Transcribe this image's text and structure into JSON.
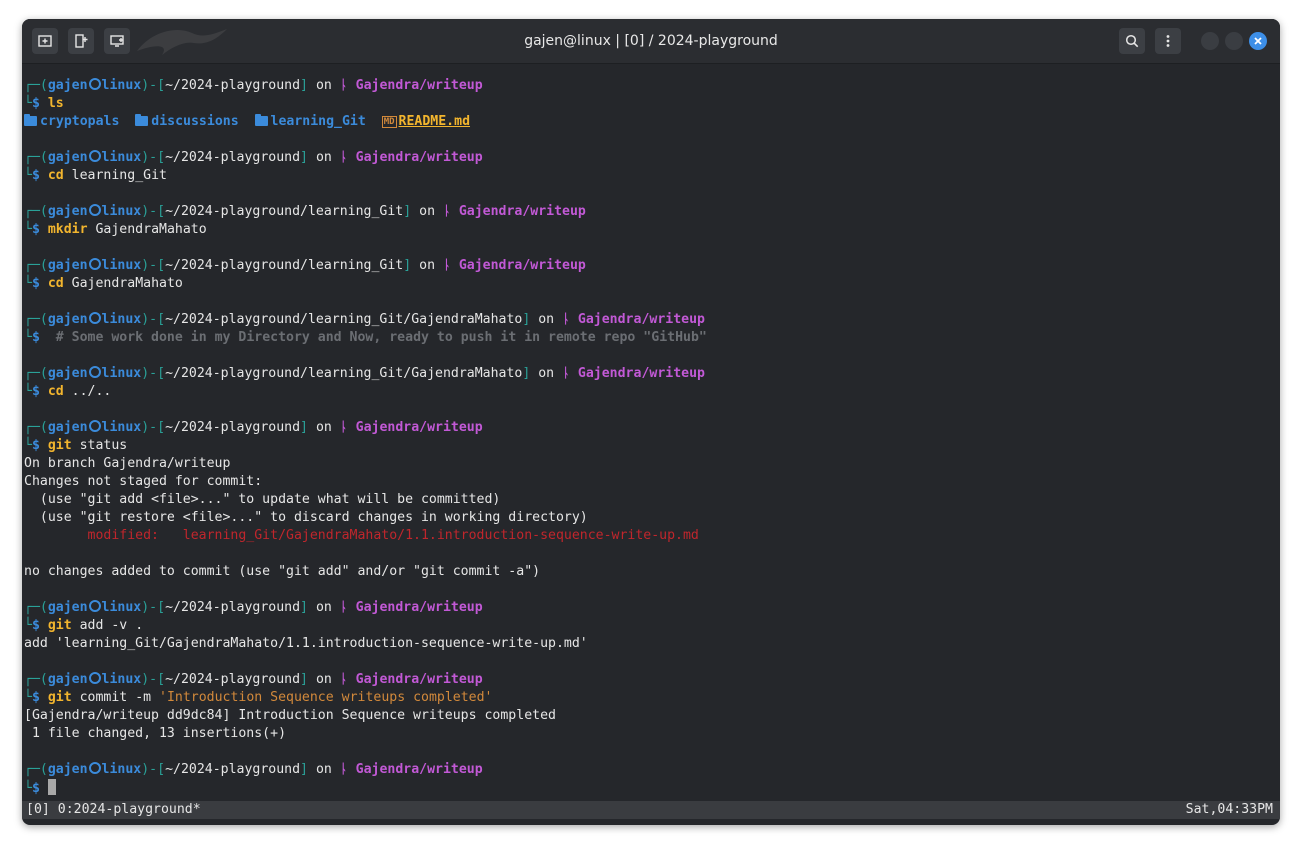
{
  "window": {
    "title": "gajen@linux | [0] / 2024-playground",
    "accent": "#3d8fe8"
  },
  "toolbar": {
    "new_tab_icon": "new-tab-icon",
    "split_icon": "split-view-icon",
    "session_icon": "session-icon",
    "search_icon": "search-icon",
    "menu_icon": "kebab-menu-icon"
  },
  "prompt": {
    "user": "gajen",
    "host": "linux",
    "on": "on",
    "branch": "Gajendra/writeup",
    "dollar": "$"
  },
  "blocks": [
    {
      "path": "~/2024-playground",
      "cmd": "ls",
      "args": ""
    },
    {
      "path": "~/2024-playground",
      "cmd": "cd",
      "args": " learning_Git"
    },
    {
      "path": "~/2024-playground/learning_Git",
      "cmd": "mkdir",
      "args": " GajendraMahato"
    },
    {
      "path": "~/2024-playground/learning_Git",
      "cmd": "cd",
      "args": " GajendraMahato"
    },
    {
      "path": "~/2024-playground/learning_Git/GajendraMahato",
      "cmd": "",
      "args": " # Some work done in my Directory and Now, ready to push it in remote repo \"GitHub\""
    },
    {
      "path": "~/2024-playground/learning_Git/GajendraMahato",
      "cmd": "cd",
      "args": " ../.."
    },
    {
      "path": "~/2024-playground",
      "cmd": "git",
      "args": " status"
    },
    {
      "path": "~/2024-playground",
      "cmd": "git",
      "args": " add -v ."
    },
    {
      "path": "~/2024-playground",
      "cmd": "git",
      "args": " commit -m ",
      "str": "'Introduction Sequence writeups completed'"
    },
    {
      "path": "~/2024-playground",
      "cmd": "",
      "args": ""
    }
  ],
  "ls_output": [
    "cryptopals",
    "discussions",
    "learning_Git",
    "README.md"
  ],
  "md_badge": "MD",
  "status_output": [
    "On branch Gajendra/writeup",
    "Changes not staged for commit:",
    "  (use \"git add <file>...\" to update what will be committed)",
    "  (use \"git restore <file>...\" to discard changes in working directory)",
    "        modified:   learning_Git/GajendraMahato/1.1.introduction-sequence-write-up.md",
    "",
    "no changes added to commit (use \"git add\" and/or \"git commit -a\")"
  ],
  "add_output": "add 'learning_Git/GajendraMahato/1.1.introduction-sequence-write-up.md'",
  "commit_output": [
    "[Gajendra/writeup dd9dc84] Introduction Sequence writeups completed",
    " 1 file changed, 13 insertions(+)"
  ],
  "statusbar": {
    "left": "[0] 0:2024-playground*",
    "right": "Sat,04:33PM"
  }
}
